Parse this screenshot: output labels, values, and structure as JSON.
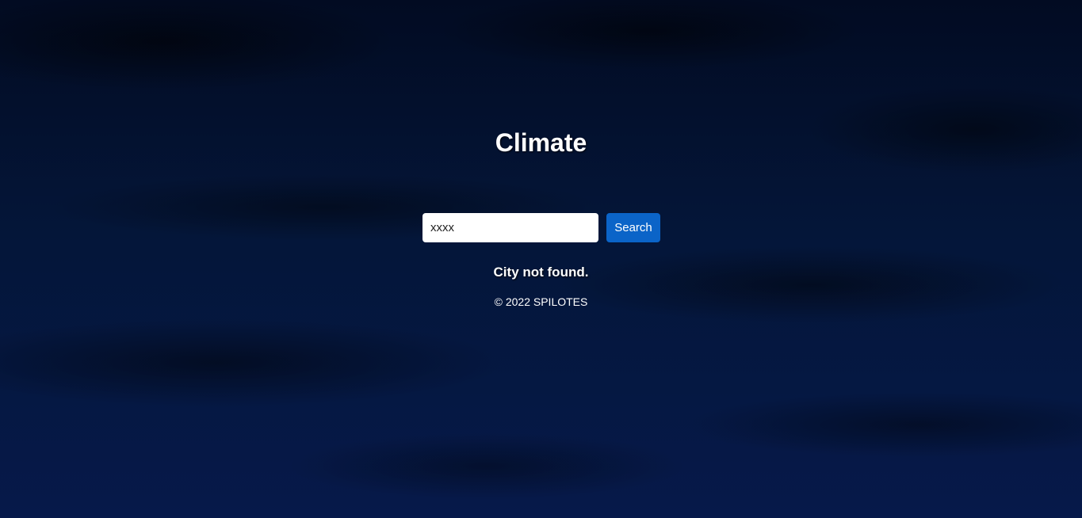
{
  "header": {
    "title": "Climate"
  },
  "search": {
    "value": "xxxx",
    "button_label": "Search"
  },
  "status": {
    "message": "City not found."
  },
  "footer": {
    "copyright": "© 2022 SPILOTES"
  },
  "colors": {
    "accent": "#0b64c8",
    "background": "#04112d",
    "text": "#ffffff"
  }
}
